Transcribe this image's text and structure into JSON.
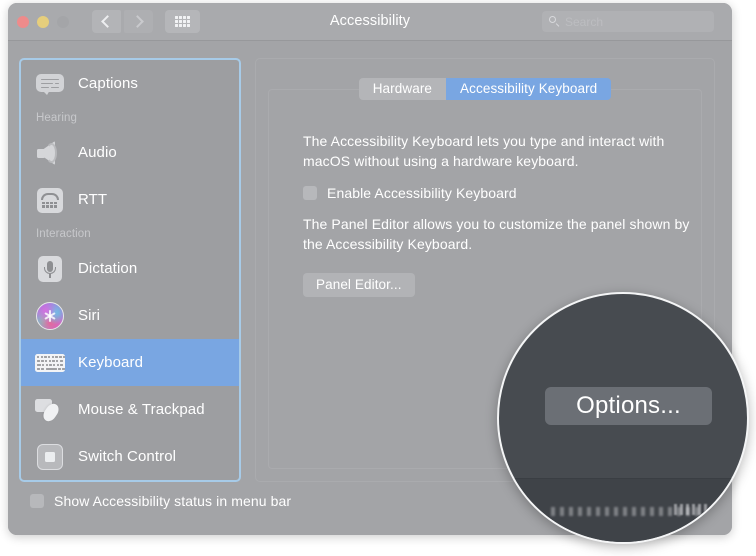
{
  "window": {
    "title": "Accessibility",
    "traffic_lights": [
      "close-red",
      "minimize-yellow",
      "zoom-disabled"
    ],
    "nav": {
      "back_icon": "chevron-left-icon",
      "forward_icon": "chevron-right-icon",
      "grid_icon": "show-all-grid-icon"
    },
    "search": {
      "placeholder": "Search",
      "value": "",
      "icon": "search-icon"
    }
  },
  "sidebar": {
    "items": [
      {
        "label": "Captions",
        "icon": "captions-icon",
        "type": "item",
        "selected": false
      },
      {
        "label": "Hearing",
        "icon": "",
        "type": "header",
        "selected": false
      },
      {
        "label": "Audio",
        "icon": "audio-speaker-icon",
        "type": "item",
        "selected": false
      },
      {
        "label": "RTT",
        "icon": "rtt-phone-icon",
        "type": "item",
        "selected": false
      },
      {
        "label": "Interaction",
        "icon": "",
        "type": "header",
        "selected": false
      },
      {
        "label": "Dictation",
        "icon": "microphone-icon",
        "type": "item",
        "selected": false
      },
      {
        "label": "Siri",
        "icon": "siri-orb-icon",
        "type": "item",
        "selected": false
      },
      {
        "label": "Keyboard",
        "icon": "keyboard-icon",
        "type": "item",
        "selected": true
      },
      {
        "label": "Mouse & Trackpad",
        "icon": "mouse-trackpad-icon",
        "type": "item",
        "selected": false
      },
      {
        "label": "Switch Control",
        "icon": "switch-control-icon",
        "type": "item",
        "selected": false
      }
    ],
    "selected_label": "Keyboard"
  },
  "footer": {
    "show_status_checkbox": {
      "label": "Show Accessibility status in menu bar",
      "checked": false
    }
  },
  "main": {
    "tabs": [
      {
        "label": "Hardware",
        "active": false
      },
      {
        "label": "Accessibility Keyboard",
        "active": true
      }
    ],
    "paragraph_1": "The Accessibility Keyboard lets you type and interact with macOS without using a hardware keyboard.",
    "enable_checkbox": {
      "label": "Enable Accessibility Keyboard",
      "checked": false
    },
    "paragraph_2": "The Panel Editor allows you to customize the panel shown by the Accessibility Keyboard.",
    "panel_editor_button": "Panel Editor..."
  },
  "magnifier": {
    "button_label": "Options...",
    "highlight_target": "options-button"
  },
  "colors": {
    "window_bg": "#a3a4a7",
    "titlebar_bg": "#a9aaad",
    "selection_blue": "#79a6e2",
    "sidebar_focus_ring": "#a7cbe8",
    "text_primary": "#ffffff",
    "text_secondary": "#c7c8cb",
    "magnifier_bg": "#474b50",
    "magnifier_button_bg": "#6b6f75",
    "traffic_red": "#ee8b8b",
    "traffic_yellow": "#e6ce7c",
    "traffic_green_disabled": "#a4a5a8"
  }
}
